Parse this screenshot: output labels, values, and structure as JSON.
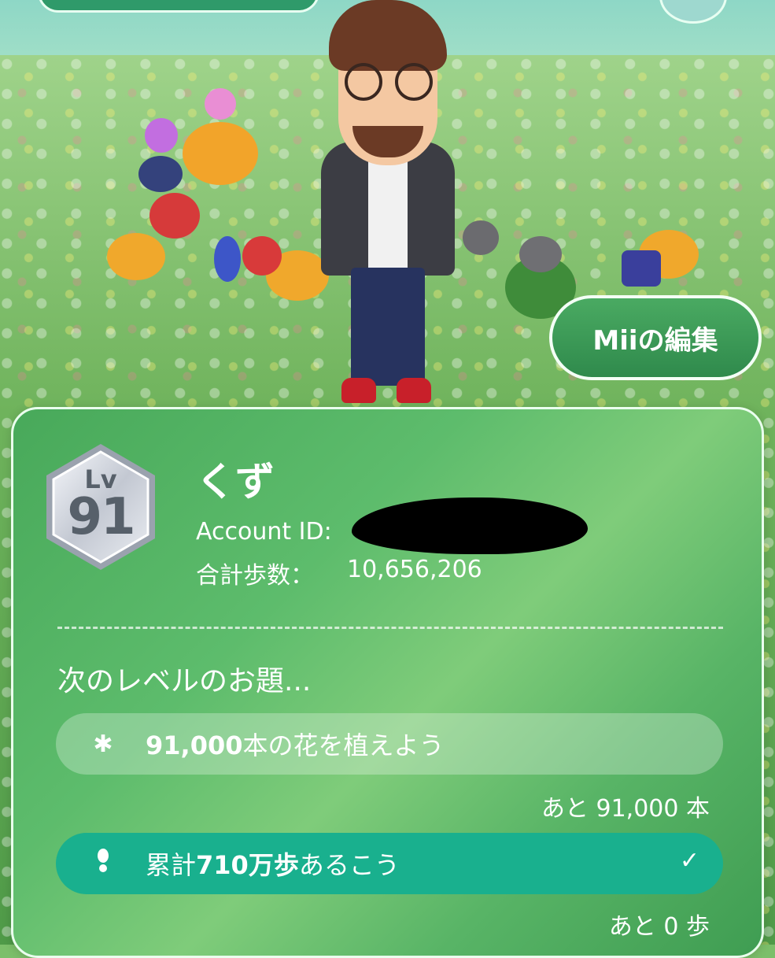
{
  "edit_button": {
    "label": "Miiの編集"
  },
  "profile": {
    "level_prefix": "Lv",
    "level": "91",
    "name": "くず",
    "account_id_label": "Account ID: ",
    "total_steps_label": "合計歩数：",
    "total_steps_value": "10,656,206"
  },
  "next_level": {
    "heading": "次のレベルのお題...",
    "tasks": [
      {
        "icon": "flower-icon",
        "text_bold": "91,000",
        "text_rest": "本の花を植えよう",
        "remaining": "あと 91,000 本",
        "completed": false
      },
      {
        "icon": "footprint-icon",
        "text_pre": "累計",
        "text_bold": "710万歩",
        "text_rest": "あるこう",
        "remaining": "あと 0 歩",
        "completed": true
      }
    ]
  },
  "colors": {
    "card_green": "#5dbc6c",
    "completed_task": "#19b08e",
    "badge_silver": "#c9ced6"
  }
}
